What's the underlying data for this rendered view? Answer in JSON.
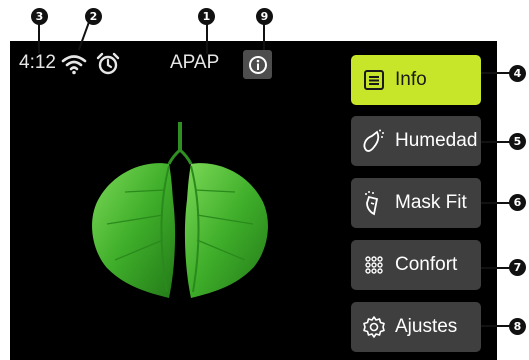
{
  "status": {
    "time": "4:12",
    "mode": "APAP"
  },
  "menu": [
    {
      "label": "Info",
      "icon": "list-icon",
      "active": true
    },
    {
      "label": "Humedad",
      "icon": "humidifier-icon",
      "active": false
    },
    {
      "label": "Mask Fit",
      "icon": "mask-icon",
      "active": false
    },
    {
      "label": "Confort",
      "icon": "grid-icon",
      "active": false
    },
    {
      "label": "Ajustes",
      "icon": "gear-icon",
      "active": false
    }
  ],
  "callouts": [
    "1",
    "2",
    "3",
    "4",
    "5",
    "6",
    "7",
    "8",
    "9"
  ],
  "colors": {
    "accent": "#c8e629",
    "button": "#3f3f3f",
    "screen": "#000000",
    "leaf": "#3fae2a"
  }
}
